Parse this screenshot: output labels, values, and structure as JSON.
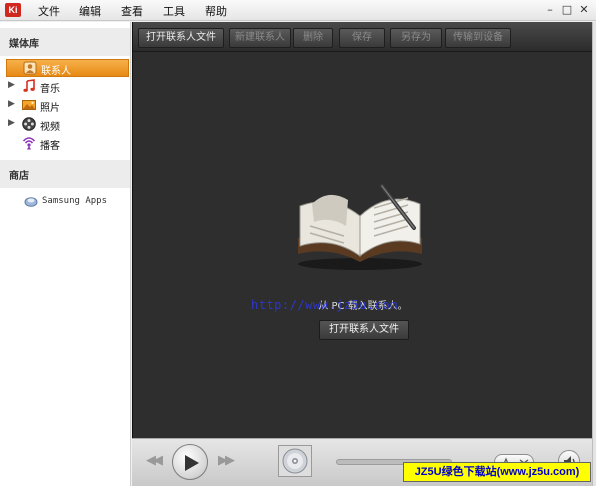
{
  "app": {
    "logo_text": "Ki",
    "menu": [
      "文件",
      "编辑",
      "查看",
      "工具",
      "帮助"
    ],
    "window_controls": [
      "–",
      "□",
      "✕"
    ]
  },
  "sidebar": {
    "library_header": "媒体库",
    "items": [
      {
        "label": "联系人",
        "icon": "contacts-icon",
        "selected": true,
        "expandable": false
      },
      {
        "label": "音乐",
        "icon": "music-icon",
        "selected": false,
        "expandable": true
      },
      {
        "label": "照片",
        "icon": "photos-icon",
        "selected": false,
        "expandable": true
      },
      {
        "label": "视频",
        "icon": "video-icon",
        "selected": false,
        "expandable": true
      },
      {
        "label": "播客",
        "icon": "podcast-icon",
        "selected": false,
        "expandable": false
      }
    ],
    "store_header": "商店",
    "store_item": {
      "label": "Samsung Apps",
      "icon": "samsung-apps-icon"
    }
  },
  "toolbar": {
    "buttons": [
      {
        "label": "打开联系人文件",
        "enabled": true
      },
      {
        "label": "新建联系人",
        "enabled": false
      },
      {
        "label": "删除",
        "enabled": false
      },
      {
        "label": "保存",
        "enabled": false
      },
      {
        "label": "另存为",
        "enabled": false
      },
      {
        "label": "传输到设备",
        "enabled": false
      }
    ]
  },
  "content": {
    "hint": "从 PC 载入联系人。",
    "open_button": "打开联系人文件",
    "watermark": "http://www.jz5u.com"
  },
  "player": {
    "prev": "◀◀",
    "next": "▶▶",
    "progress": 0,
    "mode_icon": "repeat-shuffle-icon",
    "volume_icon": "speaker-icon"
  },
  "badge": {
    "text": "JZ5U绿色下载站(www.jz5u.com)"
  },
  "colors": {
    "selection": "#e68a16",
    "main_bg": "#2e2e2e",
    "badge_bg": "#ffff00",
    "badge_text": "#0000cc",
    "watermark": "#2a38e0"
  }
}
